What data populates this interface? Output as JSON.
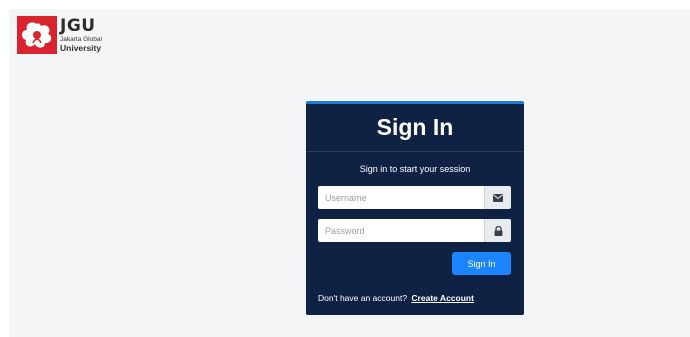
{
  "brand": {
    "name": "JGU",
    "subtitle_line1": "Jakarta Global",
    "subtitle_line2": "University",
    "logo_color": "#d9232d"
  },
  "login": {
    "title": "Sign In",
    "message": "Sign in to start your session",
    "username_placeholder": "Username",
    "username_value": "",
    "username_icon": "envelope-icon",
    "password_placeholder": "Password",
    "password_value": "",
    "password_icon": "lock-icon",
    "submit_label": "Sign In",
    "register_prompt": "Don't have an account?",
    "register_link": "Create Account"
  },
  "colors": {
    "panel_bg": "#0f2244",
    "panel_accent": "#1e7bd6",
    "button_bg": "#1a85ff",
    "page_bg": "#f4f5f7"
  }
}
